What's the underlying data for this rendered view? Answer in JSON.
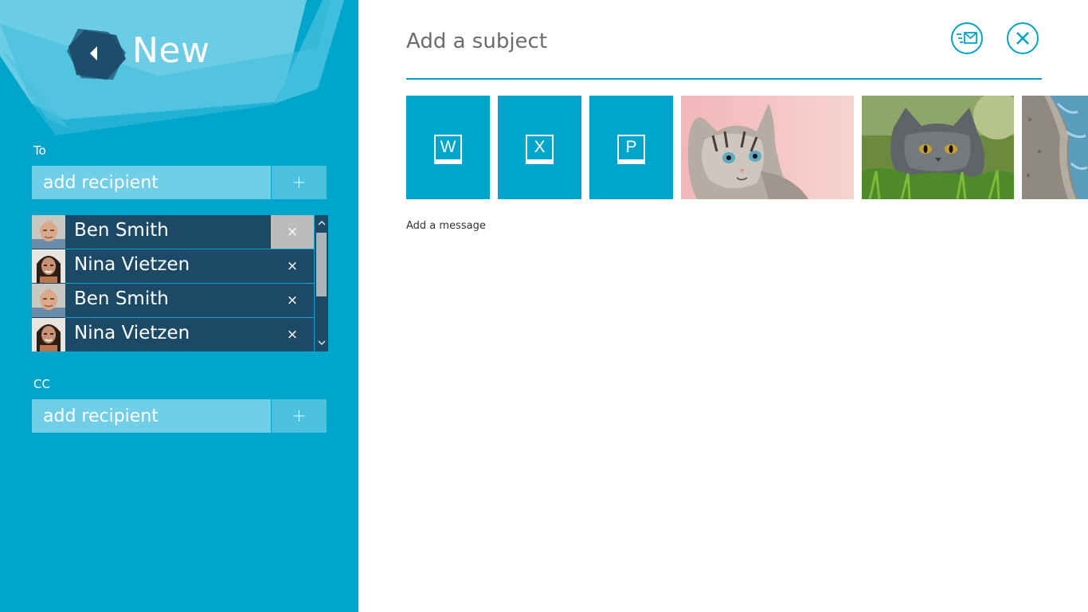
{
  "header": {
    "title": "New",
    "back_icon": "back-arrow-icon"
  },
  "to": {
    "label": "To",
    "placeholder": "add recipient",
    "add_symbol": "+",
    "recipients": [
      {
        "name": "Ben Smith",
        "remove": "×",
        "avatar": "avatar-ben"
      },
      {
        "name": "Nina Vietzen",
        "remove": "×",
        "avatar": "avatar-nina"
      },
      {
        "name": "Ben Smith",
        "remove": "×",
        "avatar": "avatar-ben"
      },
      {
        "name": "Nina Vietzen",
        "remove": "×",
        "avatar": "avatar-nina"
      }
    ]
  },
  "cc": {
    "label": "CC",
    "placeholder": "add recipient",
    "add_symbol": "+"
  },
  "subject": {
    "placeholder": "Add a subject"
  },
  "actions": {
    "send_icon": "send-mail-icon",
    "close_icon": "close-icon"
  },
  "attachments": [
    {
      "type": "office",
      "letter": "W"
    },
    {
      "type": "office",
      "letter": "X"
    },
    {
      "type": "office",
      "letter": "P"
    },
    {
      "type": "image",
      "icon": "kitten-photo"
    },
    {
      "type": "image",
      "icon": "gray-cat-photo"
    },
    {
      "type": "image",
      "icon": "water-photo"
    }
  ],
  "message": {
    "placeholder": "Add a message"
  },
  "colors": {
    "accent": "#00a5cc",
    "dark": "#1c4a66",
    "input": "#70cee6"
  }
}
